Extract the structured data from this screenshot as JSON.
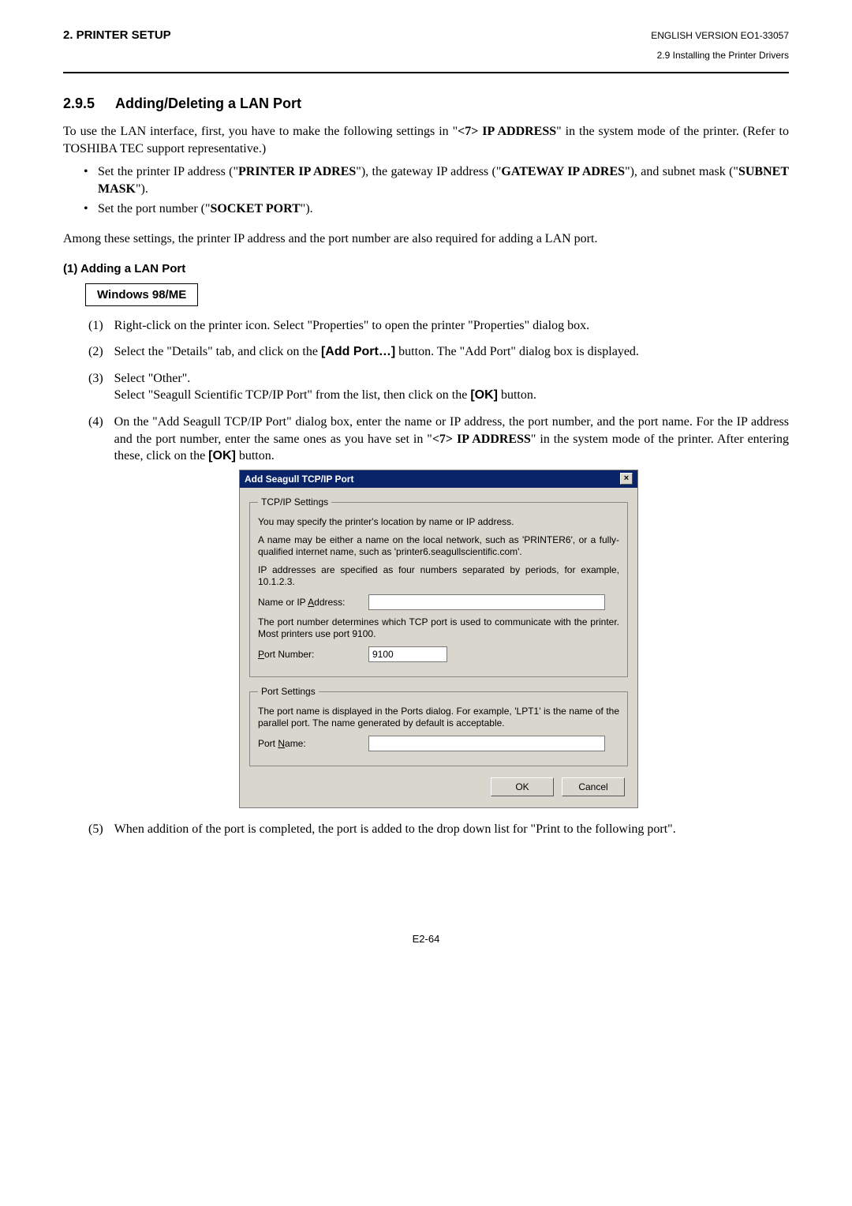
{
  "header": {
    "left": "2. PRINTER SETUP",
    "right": "ENGLISH VERSION EO1-33057",
    "sub": "2.9 Installing the Printer Drivers"
  },
  "section": {
    "number": "2.9.5",
    "title": "Adding/Deleting a LAN Port"
  },
  "intro1_a": "To use the LAN interface, first, you have to make the following settings in \"",
  "intro1_b": "<7> IP ADDRESS",
  "intro1_c": "\" in the system mode of the printer. (Refer to TOSHIBA TEC support representative.)",
  "bullet1_a": "Set the printer IP address (\"",
  "bullet1_b": "PRINTER IP ADRES",
  "bullet1_c": "\"), the gateway IP address (\"",
  "bullet1_d": "GATEWAY IP ADRES",
  "bullet1_e": "\"), and subnet mask (\"",
  "bullet1_f": "SUBNET MASK",
  "bullet1_g": "\").",
  "bullet2_a": "Set the port number (\"",
  "bullet2_b": "SOCKET PORT",
  "bullet2_c": "\").",
  "intro2": "Among these settings, the printer IP address and the port number are also required for adding a LAN port.",
  "sub_heading": "(1)  Adding a LAN Port",
  "os_box": "Windows 98/ME",
  "step1": "Right-click on the printer icon.  Select \"Properties\" to open the printer \"Properties\" dialog box.",
  "step2_a": "Select the \"Details\" tab, and click on the ",
  "step2_b": "[Add Port…]",
  "step2_c": " button.  The \"Add Port\" dialog box is displayed.",
  "step3_a": "Select \"Other\".",
  "step3_b_pre": "Select \"Seagull Scientific TCP/IP Port\" from the list, then click on the ",
  "step3_b_btn": "[OK]",
  "step3_b_post": " button.",
  "step4_a": "On the \"Add Seagull TCP/IP Port\" dialog box, enter the name or IP address, the port number, and the port name.  For the IP address and the port number, enter the same ones as you have set in \"",
  "step4_b": "<7> IP ADDRESS",
  "step4_c": "\" in the system mode of the printer.  After entering these, click on the ",
  "step4_d": "[OK]",
  "step4_e": " button.",
  "step5": "When addition of the port is completed, the port is added to the drop down list for \"Print to the following port\".",
  "step_nums": {
    "n1": "(1)",
    "n2": "(2)",
    "n3": "(3)",
    "n4": "(4)",
    "n5": "(5)"
  },
  "dialog": {
    "title": "Add Seagull TCP/IP Port",
    "close": "×",
    "group1_legend": "TCP/IP Settings",
    "p1": "You may specify the printer's location by name or IP address.",
    "p2": "A name may be either a name on the local network, such as 'PRINTER6', or a fully-qualified internet name, such as 'printer6.seagullscientific.com'.",
    "p3": "IP addresses are specified as four numbers separated by periods, for example, 10.1.2.3.",
    "label_name_pre": "Name or IP ",
    "label_name_ul": "A",
    "label_name_post": "ddress:",
    "ip_value": "",
    "p4": "The port number determines which TCP port is used to communicate with the printer.  Most printers use port 9100.",
    "label_port_ul": "P",
    "label_port_post": "ort Number:",
    "port_value": "9100",
    "group2_legend": "Port Settings",
    "p5": "The port name is displayed in the Ports dialog.  For example, 'LPT1' is the name of the parallel port.  The name generated by default is acceptable.",
    "label_pname_pre": "Port ",
    "label_pname_ul": "N",
    "label_pname_post": "ame:",
    "pname_value": "",
    "ok": "OK",
    "cancel": "Cancel"
  },
  "footer": "E2-64"
}
